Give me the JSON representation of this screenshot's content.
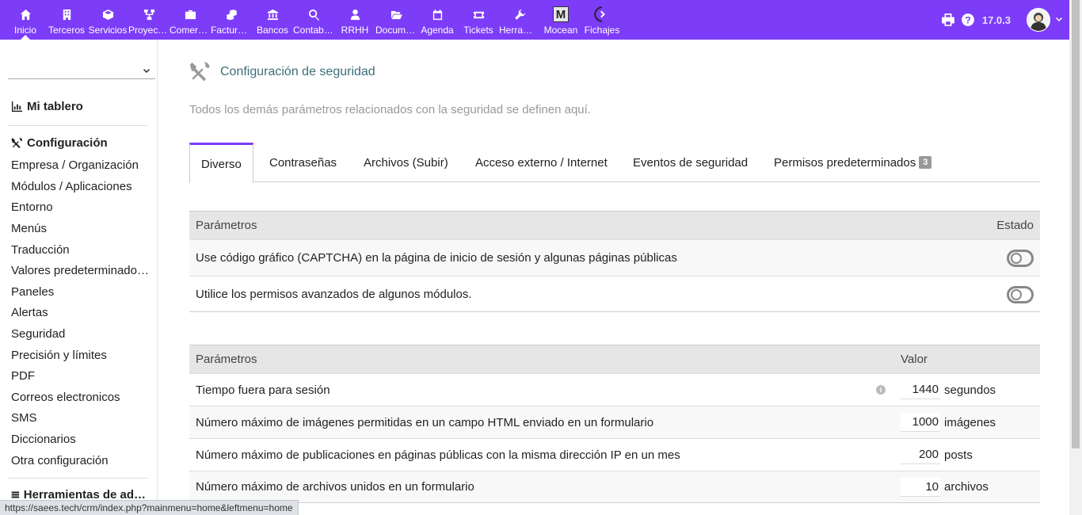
{
  "topmenu": [
    {
      "label": "Inicio",
      "icon": "home-icon",
      "active": true
    },
    {
      "label": "Terceros",
      "icon": "building-icon"
    },
    {
      "label": "Servicios",
      "icon": "cube-icon"
    },
    {
      "label": "Proyectos",
      "icon": "sitemap-icon"
    },
    {
      "label": "Comercial",
      "icon": "briefcase-icon"
    },
    {
      "label": "Facturación",
      "icon": "coins-icon"
    },
    {
      "label": "Bancos",
      "icon": "bank-icon"
    },
    {
      "label": "Contabilidad",
      "icon": "search-dollar-icon"
    },
    {
      "label": "RRHH",
      "icon": "user-tie-icon"
    },
    {
      "label": "Documentos",
      "icon": "folder-open-icon"
    },
    {
      "label": "Agenda",
      "icon": "calendar-icon"
    },
    {
      "label": "Tickets",
      "icon": "ticket-icon"
    },
    {
      "label": "Herramientas",
      "icon": "wrench-icon"
    },
    {
      "label": "Mocean",
      "icon": "m-logo-icon"
    },
    {
      "label": "Fichajes",
      "icon": "fichajes-icon"
    }
  ],
  "top_right": {
    "version": "17.0.3",
    "print_icon": "print-icon",
    "help_icon": "help-icon",
    "avatar_icon": "user-avatar-icon"
  },
  "leftmenu": {
    "select_value": "",
    "dashboard": "Mi tablero",
    "config_title": "Configuración",
    "items": [
      "Empresa / Organización",
      "Módulos / Aplicaciones",
      "Entorno",
      "Menús",
      "Traducción",
      "Valores predeterminados / Setup",
      "Paneles",
      "Alertas",
      "Seguridad",
      "Precisión y límites",
      "PDF",
      "Correos electronicos",
      "SMS",
      "Diccionarios",
      "Otra configuración"
    ],
    "tools_title": "Herramientas de administración"
  },
  "page": {
    "title": "Configuración de seguridad",
    "description": "Todos los demás parámetros relacionados con la seguridad se definen aquí."
  },
  "tabs": [
    {
      "label": "Diverso",
      "active": true
    },
    {
      "label": "Contraseñas"
    },
    {
      "label": "Archivos (Subir)"
    },
    {
      "label": "Acceso externo / Internet"
    },
    {
      "label": "Eventos de seguridad"
    },
    {
      "label": "Permisos predeterminados",
      "badge": "3"
    }
  ],
  "table1": {
    "col_param": "Parámetros",
    "col_state": "Estado",
    "rows": [
      {
        "label": "Use código gráfico (CAPTCHA) en la página de inicio de sesión y algunas páginas públicas",
        "enabled": false
      },
      {
        "label": "Utilice los permisos avanzados de algunos módulos.",
        "enabled": false
      }
    ]
  },
  "table2": {
    "col_param": "Parámetros",
    "col_value": "Valor",
    "rows": [
      {
        "label": "Tiempo fuera para sesión",
        "value": "1440",
        "unit": "segundos",
        "info": "i"
      },
      {
        "label": "Número máximo de imágenes permitidas en un campo HTML enviado en un formulario",
        "value": "1000",
        "unit": "imágenes"
      },
      {
        "label": "Número máximo de publicaciones en páginas públicas con la misma dirección IP en un mes",
        "value": "200",
        "unit": "posts"
      },
      {
        "label": "Número máximo de archivos unidos en un formulario",
        "value": "10",
        "unit": "archivos"
      }
    ]
  },
  "statusbar": "https://saees.tech/crm/index.php?mainmenu=home&leftmenu=home"
}
